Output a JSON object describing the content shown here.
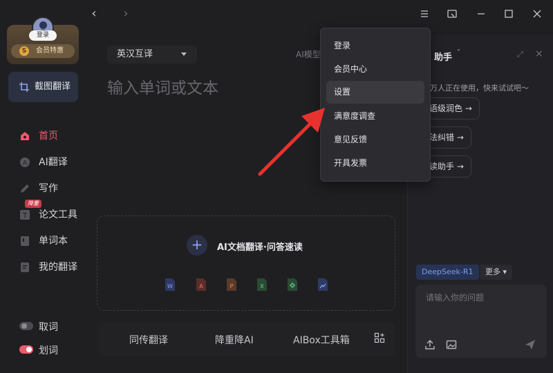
{
  "colors": {
    "accent_red": "#f05a6a",
    "accent_blue": "#7f9cf0",
    "background": "#1f1f22",
    "menu_bg": "#2c2c30",
    "arrow": "#e8322e"
  },
  "sidebar": {
    "login_label": "登录",
    "vip_label": "会员特惠",
    "vip_icon_text": "S",
    "screenshot_translate_label": "截图翻译",
    "items": [
      {
        "label": "首页",
        "icon": "home-icon"
      },
      {
        "label": "AI翻译",
        "icon": "ai-translate-icon"
      },
      {
        "label": "写作",
        "icon": "pen-icon"
      },
      {
        "label": "论文工具",
        "icon": "paper-icon",
        "badge": "降重"
      },
      {
        "label": "单词本",
        "icon": "wordbook-icon"
      },
      {
        "label": "我的翻译",
        "icon": "my-translation-icon"
      }
    ],
    "toggles": [
      {
        "label": "取词",
        "on": false
      },
      {
        "label": "划词",
        "on": true
      }
    ]
  },
  "titlebar": {
    "back_icon": "chevron-left-icon",
    "forward_icon": "chevron-right-icon",
    "back_glyph": "‹",
    "forward_glyph": "›",
    "buttons": [
      "menu-icon",
      "mini-window-icon",
      "minimize-icon",
      "maximize-icon",
      "close-icon"
    ]
  },
  "main": {
    "language_pair": "英汉互译",
    "ai_model_label": "AI模型",
    "input_placeholder": "输入单词或文本",
    "doc_zone": {
      "plus": "+",
      "title": "AI文档翻译·问答速读",
      "file_types": [
        "word-icon",
        "pdf-icon",
        "ppt-icon",
        "excel-icon",
        "epub-icon",
        "image-icon"
      ]
    },
    "bottom_tools": [
      "同传翻译",
      "降重降AI",
      "AIBox工具箱"
    ]
  },
  "assistant": {
    "title": "助手",
    "caret": "˅",
    "expand": "⤢",
    "close": "×",
    "subtitle": "万人正在使用，快来试试吧～",
    "chips": [
      "语级润色 →",
      "法纠错 →",
      "读助手 →"
    ],
    "model": "DeepSeek-R1",
    "more": "更多 ▾",
    "chat_placeholder": "请输入你的问题"
  },
  "dropdown_menu": {
    "items": [
      "登录",
      "会员中心",
      "设置",
      "满意度调查",
      "意见反馈",
      "开具发票"
    ],
    "highlighted": "设置"
  }
}
